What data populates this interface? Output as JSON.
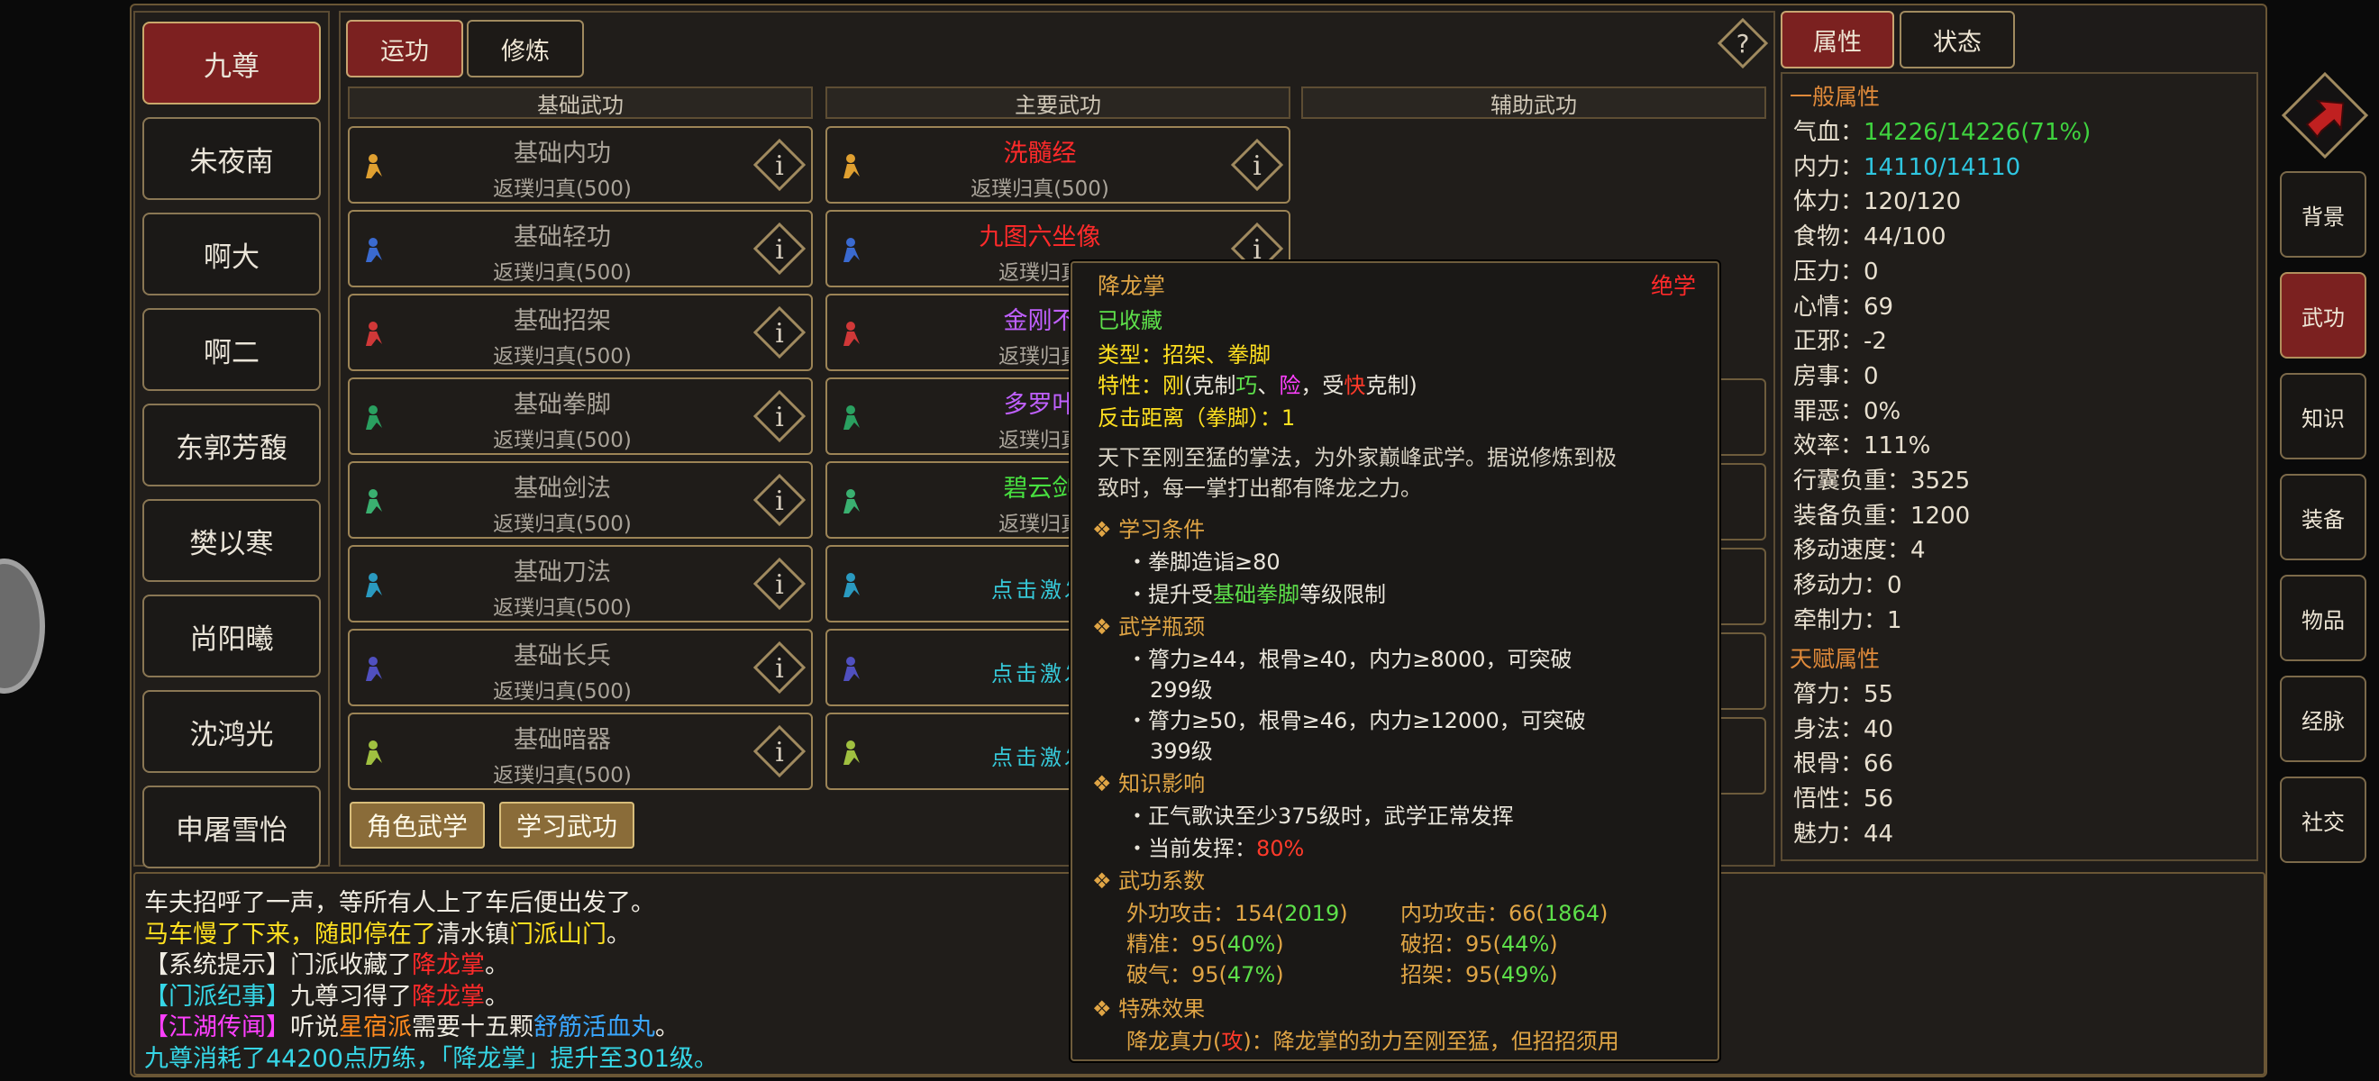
{
  "characters": [
    "九尊",
    "朱夜南",
    "啊大",
    "啊二",
    "东郭芳馥",
    "樊以寒",
    "尚阳曦",
    "沈鸿光",
    "申屠雪怡"
  ],
  "tabs": {
    "practice": "运功",
    "cultivate": "修炼"
  },
  "help_symbol": "?",
  "columns": {
    "basic": "基础武功",
    "main": "主要武功",
    "aux": "辅助武功"
  },
  "basic_skills": [
    {
      "name": "基础内功",
      "level": "返璞归真(500)"
    },
    {
      "name": "基础轻功",
      "level": "返璞归真(500)"
    },
    {
      "name": "基础招架",
      "level": "返璞归真(500)"
    },
    {
      "name": "基础拳脚",
      "level": "返璞归真(500)"
    },
    {
      "name": "基础剑法",
      "level": "返璞归真(500)"
    },
    {
      "name": "基础刀法",
      "level": "返璞归真(500)"
    },
    {
      "name": "基础长兵",
      "level": "返璞归真(500)"
    },
    {
      "name": "基础暗器",
      "level": "返璞归真(500)"
    }
  ],
  "main_skills": [
    {
      "name": "洗髓经",
      "level": "返璞归真(500)",
      "color": "#ff2a2a"
    },
    {
      "name": "九图六坐像",
      "level": "返璞归真",
      "color": "#ff2a2a"
    },
    {
      "name": "金刚不",
      "level": "返璞归真",
      "color": "#c060ff"
    },
    {
      "name": "多罗叶",
      "level": "返璞归真",
      "color": "#c060ff"
    },
    {
      "name": "碧云剑",
      "level": "返璞归真",
      "color": "#48e040"
    },
    {
      "name": "点击激发",
      "level": "",
      "color": "#36c8d8"
    },
    {
      "name": "点击激发",
      "level": "",
      "color": "#36c8d8"
    },
    {
      "name": "点击激发",
      "level": "",
      "color": "#36c8d8"
    }
  ],
  "bottom_buttons": {
    "role_martial": "角色武学",
    "learn_martial": "学习武功"
  },
  "right_tabs": {
    "attributes": "属性",
    "status": "状态"
  },
  "general_title": "一般属性",
  "general_attrs": [
    {
      "label": "气血：",
      "value": "14226/14226(71%)",
      "color": "#3fd33f"
    },
    {
      "label": "内力：",
      "value": "14110/14110",
      "color": "#2fc6e0"
    },
    {
      "label": "体力：",
      "value": "120/120"
    },
    {
      "label": "食物：",
      "value": "44/100"
    },
    {
      "label": "压力：",
      "value": "0"
    },
    {
      "label": "心情：",
      "value": "69"
    },
    {
      "label": "正邪：",
      "value": "-2"
    },
    {
      "label": "房事：",
      "value": "0"
    },
    {
      "label": "罪恶：",
      "value": "0%"
    },
    {
      "label": "效率：",
      "value": "111%"
    },
    {
      "label": "行囊负重：",
      "value": "3525"
    },
    {
      "label": "装备负重：",
      "value": "1200"
    },
    {
      "label": "移动速度：",
      "value": "4"
    },
    {
      "label": "移动力：",
      "value": "0"
    },
    {
      "label": "牵制力：",
      "value": "1"
    }
  ],
  "talent_title": "天赋属性",
  "talent_attrs": [
    {
      "label": "膂力：",
      "value": "55"
    },
    {
      "label": "身法：",
      "value": "40"
    },
    {
      "label": "根骨：",
      "value": "66"
    },
    {
      "label": "悟性：",
      "value": "56"
    },
    {
      "label": "魅力：",
      "value": "44"
    }
  ],
  "side_buttons": [
    "背景",
    "武功",
    "知识",
    "装备",
    "物品",
    "经脉",
    "社交"
  ],
  "log": [
    {
      "parts": [
        {
          "t": "车夫招呼了一声，等所有人上了车后便出发了。",
          "c": "#f0ece2"
        }
      ]
    },
    {
      "parts": [
        {
          "t": "马车慢了下来，随即停在了",
          "c": "#ffe020"
        },
        {
          "t": "清水镇",
          "c": "#f0ece2"
        },
        {
          "t": "门派山门",
          "c": "#ffe020"
        },
        {
          "t": "。",
          "c": "#f0ece2"
        }
      ]
    },
    {
      "parts": [
        {
          "t": "【系统提示】门派收藏了",
          "c": "#f0ece2"
        },
        {
          "t": "降龙掌",
          "c": "#ff2a2a"
        },
        {
          "t": "。",
          "c": "#f0ece2"
        }
      ]
    },
    {
      "parts": [
        {
          "t": "【门派纪事】",
          "c": "#36d6e6"
        },
        {
          "t": "九尊习得了",
          "c": "#f0ece2"
        },
        {
          "t": "降龙掌",
          "c": "#ff2a2a"
        },
        {
          "t": "。",
          "c": "#f0ece2"
        }
      ]
    },
    {
      "parts": [
        {
          "t": "【江湖传闻】",
          "c": "#ff40ff"
        },
        {
          "t": "听说",
          "c": "#f0ece2"
        },
        {
          "t": "星宿派",
          "c": "#ff8a1e"
        },
        {
          "t": "需要十五颗",
          "c": "#f0ece2"
        },
        {
          "t": "舒筋活血丸",
          "c": "#3aa6ff"
        },
        {
          "t": "。",
          "c": "#f0ece2"
        }
      ]
    },
    {
      "parts": [
        {
          "t": "九尊消耗了44200点历练，「降龙掌」提升至301级。",
          "c": "#36d6e6"
        }
      ]
    }
  ],
  "tooltip": {
    "name": "降龙掌",
    "grade": "绝学",
    "collected": "已收藏",
    "type": "类型：招架、拳脚",
    "trait_prefix": "特性：",
    "trait_gang": "刚",
    "trait_mid1": "(克制",
    "trait_qiao": "巧",
    "trait_sep": "、",
    "trait_xian": "险",
    "trait_mid2": "，受",
    "trait_kuai": "快",
    "trait_end": "克制)",
    "range": "反击距离（拳脚）：1",
    "desc1": "天下至刚至猛的掌法，为外家巅峰武学。据说修炼到极",
    "desc2": "致时，每一掌打出都有降龙之力。",
    "learn_title": "学习条件",
    "learn1": "・拳脚造诣≥80",
    "learn2_a": "・提升受",
    "learn2_b": "基础拳脚",
    "learn2_c": "等级限制",
    "bottleneck_title": "武学瓶颈",
    "bn1a": "・膂力≥44，根骨≥40，内力≥8000，可突破",
    "bn1b": "299级",
    "bn2a": "・膂力≥50，根骨≥46，内力≥12000，可突破",
    "bn2b": "399级",
    "knowledge_title": "知识影响",
    "kn1": "・正气歌诀至少375级时，武学正常发挥",
    "kn2_a": "・当前发挥：",
    "kn2_b": "80%",
    "coeff_title": "武功系数",
    "c_outer_a": "外功攻击：154(",
    "c_outer_b": "2019",
    "c_outer_c": ")",
    "c_inner_a": "内功攻击：66(",
    "c_inner_b": "1864",
    "c_inner_c": ")",
    "c_acc_a": "精准：95(",
    "c_acc_b": "40%",
    "c_acc_c": ")",
    "c_brk_a": "破招：95(",
    "c_brk_b": "44%",
    "c_brk_c": ")",
    "c_qi_a": "破气：95(",
    "c_qi_b": "47%",
    "c_qi_c": ")",
    "c_par_a": "招架：95(",
    "c_par_b": "49%",
    "c_par_c": ")",
    "special_title": "特殊效果",
    "sp_a": "降龙真力(",
    "sp_b": "攻",
    "sp_c": ")：降龙掌的劲力至刚至猛，但招招须用"
  },
  "colors": {
    "accent_red": "#7b2120",
    "gold": "#c7a470"
  }
}
